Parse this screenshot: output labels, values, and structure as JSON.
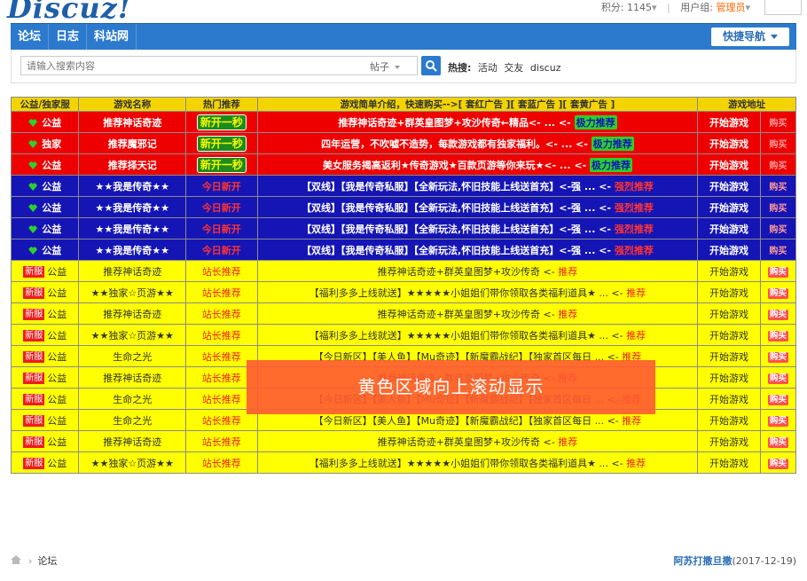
{
  "header": {
    "logo": "Discuz!",
    "points_label": "积分: 1145",
    "group_label": "用户组: ",
    "group_value": "管理员"
  },
  "nav": {
    "tabs": [
      "论坛",
      "日志",
      "科站网"
    ],
    "quick_nav": "快捷导航"
  },
  "search": {
    "placeholder": "请输入搜索内容",
    "type": "帖子",
    "hot_label": "热搜:",
    "hot_keywords": [
      "活动",
      "交友",
      "discuz"
    ]
  },
  "table": {
    "headers": [
      "公益/独家服",
      "游戏名称",
      "热门推荐",
      "游戏简单介绍，快速购买-->[ 套红广告 ][ 套蓝广告 ][ 套黄广告 ]",
      "游戏地址",
      ""
    ],
    "rows": [
      {
        "style": "red",
        "type": "公益",
        "name": "推荐神话奇迹",
        "hot": "新开一秒",
        "desc": "推荐神话奇迹+群英皇图梦+攻沙传奇←精品<- ... <-",
        "desc_end": "极力推荐",
        "link": "开始游戏",
        "buy": "购买"
      },
      {
        "style": "red",
        "type": "独家",
        "name": "推荐魔邪记",
        "hot": "新开一秒",
        "desc": "四年运营，不吹嘘不造势，每款游戏都有独家福利。<- ... <-",
        "desc_end": "极力推荐",
        "link": "开始游戏",
        "buy": "购买"
      },
      {
        "style": "red",
        "type": "公益",
        "name": "推荐择天记",
        "hot": "新开一秒",
        "desc": "美女服务揭高返利★传奇游戏★百款页游等你来玩★<- ... <-",
        "desc_end": "极力推荐",
        "link": "开始游戏",
        "buy": "购买"
      },
      {
        "style": "blue",
        "type": "公益",
        "name": "★★我是传奇★★",
        "hot": "今日新开",
        "desc": "【双线】【我是传奇私服】【全新玩法,怀旧技能上线送首充】<-强 ... <-",
        "desc_end": "强烈推荐",
        "link": "开始游戏",
        "buy": "购买"
      },
      {
        "style": "blue",
        "type": "公益",
        "name": "★★我是传奇★★",
        "hot": "今日新开",
        "desc": "【双线】【我是传奇私服】【全新玩法,怀旧技能上线送首充】<-强 ... <-",
        "desc_end": "强烈推荐",
        "link": "开始游戏",
        "buy": "购买"
      },
      {
        "style": "blue",
        "type": "公益",
        "name": "★★我是传奇★★",
        "hot": "今日新开",
        "desc": "【双线】【我是传奇私服】【全新玩法,怀旧技能上线送首充】<-强 ... <-",
        "desc_end": "强烈推荐",
        "link": "开始游戏",
        "buy": "购买"
      },
      {
        "style": "blue",
        "type": "公益",
        "name": "★★我是传奇★★",
        "hot": "今日新开",
        "desc": "【双线】【我是传奇私服】【全新玩法,怀旧技能上线送首充】<-强 ... <-",
        "desc_end": "强烈推荐",
        "link": "开始游戏",
        "buy": "购买"
      },
      {
        "style": "yellow",
        "badge": "新服",
        "type": "公益",
        "name": "推荐神话奇迹",
        "hot": "站长推荐",
        "desc": "推荐神话奇迹+群英皇图梦+攻沙传奇 <-",
        "desc_end": "推荐",
        "link": "开始游戏",
        "buy": "购买"
      },
      {
        "style": "yellow",
        "badge": "新服",
        "type": "公益",
        "name": "★★独家☆页游★★",
        "hot": "站长推荐",
        "desc": "【福利多多上线就送】★★★★★小姐姐们带你领取各类福利道具★ ... <-",
        "desc_end": "推荐",
        "link": "开始游戏",
        "buy": "购买"
      },
      {
        "style": "yellow",
        "badge": "新服",
        "type": "公益",
        "name": "推荐神话奇迹",
        "hot": "站长推荐",
        "desc": "推荐神话奇迹+群英皇图梦+攻沙传奇 <-",
        "desc_end": "推荐",
        "link": "开始游戏",
        "buy": "购买"
      },
      {
        "style": "yellow",
        "badge": "新服",
        "type": "公益",
        "name": "★★独家☆页游★★",
        "hot": "站长推荐",
        "desc": "【福利多多上线就送】★★★★★小姐姐们带你领取各类福利道具★ ... <-",
        "desc_end": "推荐",
        "link": "开始游戏",
        "buy": "购买"
      },
      {
        "style": "yellow",
        "badge": "新服",
        "type": "公益",
        "name": "生命之光",
        "hot": "站长推荐",
        "desc": "【今日新区】【美人鱼】【Mu奇迹】【新魔霸战纪】【独家首区每日 ... <-",
        "desc_end": "推荐",
        "link": "开始游戏",
        "buy": "购买"
      },
      {
        "style": "yellow",
        "badge": "新服",
        "type": "公益",
        "name": "推荐神话奇迹",
        "hot": "站长推荐",
        "desc": "推荐神话奇迹+群英皇图梦+攻沙传奇 <-",
        "desc_end": "推荐",
        "link": "开始游戏",
        "buy": "购买"
      },
      {
        "style": "yellow",
        "badge": "新服",
        "type": "公益",
        "name": "生命之光",
        "hot": "站长推荐",
        "desc": "【今日新区】【美人鱼】【Mu奇迹】【新魔霸战纪】【独家首区每日 ... <-",
        "desc_end": "推荐",
        "link": "开始游戏",
        "buy": "购买"
      },
      {
        "style": "yellow",
        "badge": "新服",
        "type": "公益",
        "name": "生命之光",
        "hot": "站长推荐",
        "desc": "【今日新区】【美人鱼】【Mu奇迹】【新魔霸战纪】【独家首区每日 ... <-",
        "desc_end": "推荐",
        "link": "开始游戏",
        "buy": "购买"
      },
      {
        "style": "yellow",
        "badge": "新服",
        "type": "公益",
        "name": "推荐神话奇迹",
        "hot": "站长推荐",
        "desc": "推荐神话奇迹+群英皇图梦+攻沙传奇 <-",
        "desc_end": "推荐",
        "link": "开始游戏",
        "buy": "购买"
      },
      {
        "style": "yellow",
        "badge": "新服",
        "type": "公益",
        "name": "★★独家☆页游★★",
        "hot": "站长推荐",
        "desc": "【福利多多上线就送】★★★★★小姐姐们带你领取各类福利道具★ ... <-",
        "desc_end": "推荐",
        "link": "开始游戏",
        "buy": "购买"
      }
    ]
  },
  "overlay": "黄色区域向上滚动显示",
  "footer": {
    "breadcrumb": "论坛",
    "author": "阿苏打撒旦撒",
    "date": "(2017-12-19)"
  }
}
